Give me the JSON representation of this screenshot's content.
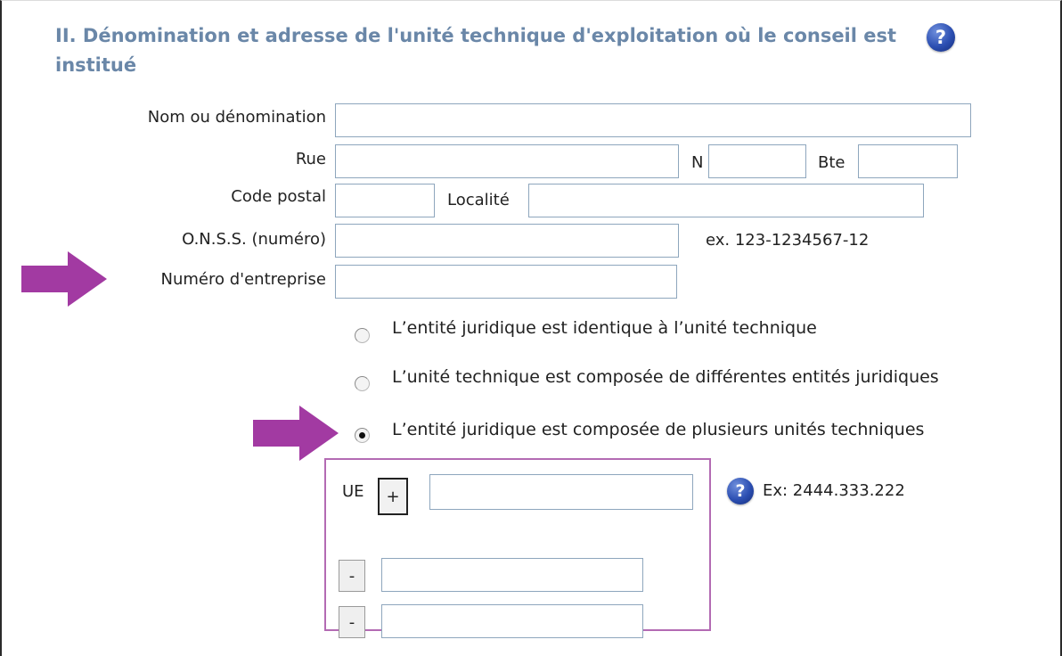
{
  "section": {
    "title": "II. Dénomination et adresse de l'unité technique d'exploitation où le conseil est institué",
    "help_glyph": "?"
  },
  "fields": {
    "nom_label": "Nom ou dénomination",
    "nom_value": "",
    "rue_label": "Rue",
    "rue_value": "",
    "n_label": "N",
    "n_value": "",
    "bte_label": "Bte",
    "bte_value": "",
    "code_postal_label": "Code postal",
    "code_postal_value": "",
    "localite_label": "Localité",
    "localite_value": "",
    "onss_label": "O.N.S.S. (numéro)",
    "onss_value": "",
    "onss_example": "ex. 123-1234567-12",
    "entreprise_label": "Numéro d'entreprise",
    "entreprise_value": ""
  },
  "radio_options": [
    {
      "label": "L’entité juridique est identique à l’unité technique",
      "checked": false
    },
    {
      "label": "L’unité technique est composée de différentes entités juridiques",
      "checked": false
    },
    {
      "label": "L’entité juridique est composée de plusieurs unités techniques",
      "checked": true
    }
  ],
  "ue_section": {
    "label": "UE",
    "add_label": "+",
    "value": "",
    "help_glyph": "?",
    "example": "Ex: 2444.333.222",
    "rows": [
      {
        "remove_label": "-",
        "value": ""
      },
      {
        "remove_label": "-",
        "value": ""
      }
    ]
  },
  "colors": {
    "title": "#6a87a8",
    "field_border": "#8ea6bd",
    "arrow": "#a23aa2",
    "ue_box_border": "#b36bb3",
    "help_icon": "#2c4fb2"
  },
  "icons": [
    "help-icon",
    "arrow-icon",
    "radio-icon"
  ]
}
